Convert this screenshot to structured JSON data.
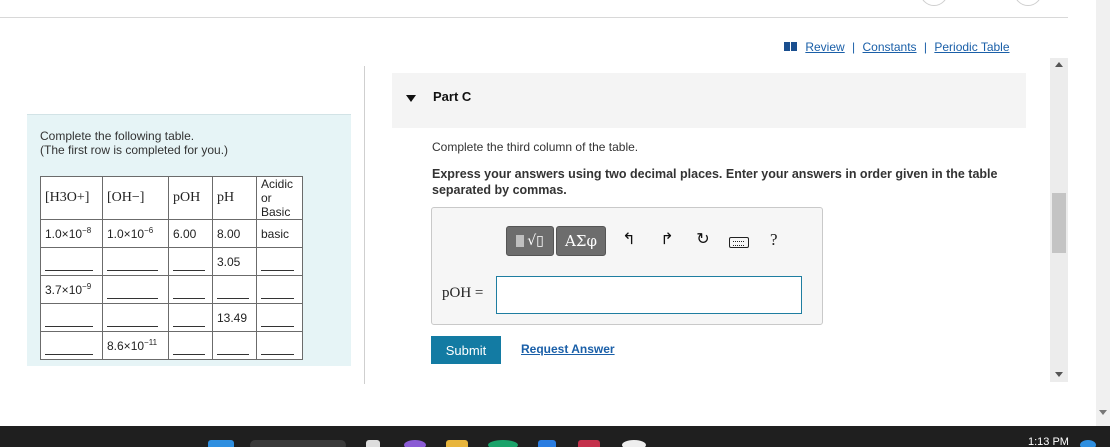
{
  "header_links": {
    "review": "Review",
    "constants": "Constants",
    "periodic_table": "Periodic Table",
    "separator": "|"
  },
  "left_panel": {
    "instruction_line1": "Complete the following table.",
    "instruction_line2": "(The first row is completed for you.)",
    "table": {
      "headers": {
        "h3o": "[H3O+]",
        "oh": "[OH−]",
        "poh": "pOH",
        "ph": "pH",
        "acid_basic_line1": "Acidic or",
        "acid_basic_line2": "Basic"
      },
      "rows": [
        {
          "h3o": "1.0×10",
          "h3o_exp": "−8",
          "oh": "1.0×10",
          "oh_exp": "−6",
          "poh": "6.00",
          "ph": "8.00",
          "ab": "basic"
        },
        {
          "ph": "3.05"
        },
        {
          "h3o": "3.7×10",
          "h3o_exp": "−9"
        },
        {
          "ph": "13.49"
        },
        {
          "oh": "8.6×10",
          "oh_exp": "−11"
        }
      ]
    }
  },
  "part": {
    "title": "Part C",
    "question": "Complete the third column of the table.",
    "instructions": "Express your answers using two decimal places. Enter your answers in order given in the table separated by commas."
  },
  "answer": {
    "greek_label": "ΑΣφ",
    "help_label": "?",
    "poh_label": "pOH =",
    "value": ""
  },
  "actions": {
    "submit": "Submit",
    "request_answer": "Request Answer"
  },
  "taskbar": {
    "clock": "1:13 PM"
  }
}
